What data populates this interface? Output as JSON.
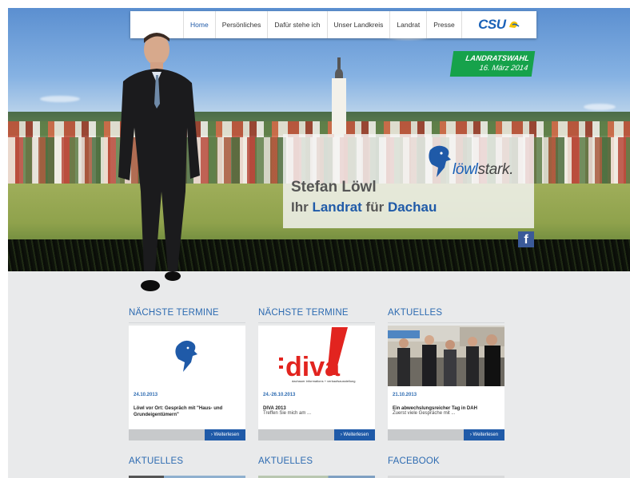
{
  "nav": {
    "items": [
      "Home",
      "Persönliches",
      "Dafür stehe ich",
      "Unser Landkreis",
      "Landrat",
      "Presse"
    ],
    "active_index": 0,
    "party_logo_text": "CSU"
  },
  "hero": {
    "badge_line1": "LANDRATSWAHL",
    "badge_line2": "16. März 2014",
    "brand_prefix": "löwl",
    "brand_suffix": "stark.",
    "candidate_name": "Stefan Löwl",
    "slogan_1": "Ihr",
    "slogan_2": "Landrat",
    "slogan_3": "für",
    "slogan_4": "Dachau",
    "facebook_icon": "f"
  },
  "cards": [
    {
      "heading": "NÄCHSTE TERMINE",
      "date": "24.10.2013",
      "title": "Löwl vor Ort: Gespräch mit \"Haus- und Grundeigentümern\"",
      "text": "",
      "more": "› Weiterlesen",
      "image": "lion-icon"
    },
    {
      "heading": "NÄCHSTE TERMINE",
      "date": "24.-26.10.2013",
      "title": "DIVA 2013",
      "text": "Treffen Sie mich am ...",
      "more": "› Weiterlesen",
      "image": "diva-logo",
      "image_text": "diva",
      "image_sub": "dachauer informations + verkaufsausstellung"
    },
    {
      "heading": "AKTUELLES",
      "date": "21.10.2013",
      "title": "Ein abwechslungsreicher Tag in DAH",
      "text": "Zuerst viele Gespräche mit ...",
      "more": "› Weiterlesen",
      "image": "event-photo"
    }
  ],
  "row2_headings": [
    "AKTUELLES",
    "AKTUELLES",
    "FACEBOOK"
  ],
  "colors": {
    "brand_blue": "#1f5aa8",
    "badge_green": "#16a24b",
    "heading_blue": "#2d6bb1"
  }
}
